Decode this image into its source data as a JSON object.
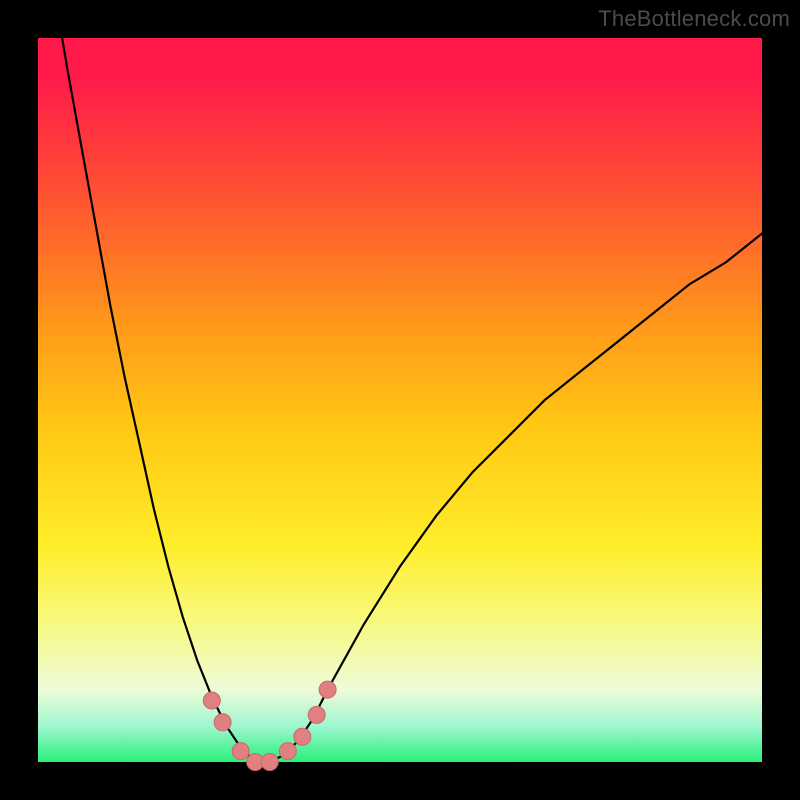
{
  "watermark": "TheBottleneck.com",
  "colors": {
    "curve": "#000000",
    "marker_fill": "#e08080",
    "marker_stroke": "#c86a6a",
    "gradient_top": "#ff1a4b",
    "gradient_bottom": "#29f079"
  },
  "chart_data": {
    "type": "line",
    "title": "",
    "xlabel": "",
    "ylabel": "",
    "xlim": [
      0,
      1
    ],
    "ylim": [
      0,
      1
    ],
    "x": [
      0.0,
      0.02,
      0.04,
      0.06,
      0.08,
      0.1,
      0.12,
      0.14,
      0.16,
      0.18,
      0.2,
      0.22,
      0.24,
      0.26,
      0.28,
      0.3,
      0.32,
      0.34,
      0.36,
      0.38,
      0.4,
      0.45,
      0.5,
      0.55,
      0.6,
      0.65,
      0.7,
      0.75,
      0.8,
      0.85,
      0.9,
      0.95,
      1.0
    ],
    "y": [
      1.2,
      1.08,
      0.96,
      0.85,
      0.74,
      0.63,
      0.53,
      0.44,
      0.35,
      0.27,
      0.2,
      0.14,
      0.09,
      0.05,
      0.02,
      0.0,
      0.0,
      0.01,
      0.03,
      0.06,
      0.1,
      0.19,
      0.27,
      0.34,
      0.4,
      0.45,
      0.5,
      0.54,
      0.58,
      0.62,
      0.66,
      0.69,
      0.73
    ],
    "markers": {
      "x": [
        0.24,
        0.255,
        0.28,
        0.3,
        0.32,
        0.345,
        0.365,
        0.385,
        0.4
      ],
      "y": [
        0.085,
        0.055,
        0.015,
        0.0,
        0.0,
        0.015,
        0.035,
        0.065,
        0.1
      ]
    },
    "annotations": []
  }
}
